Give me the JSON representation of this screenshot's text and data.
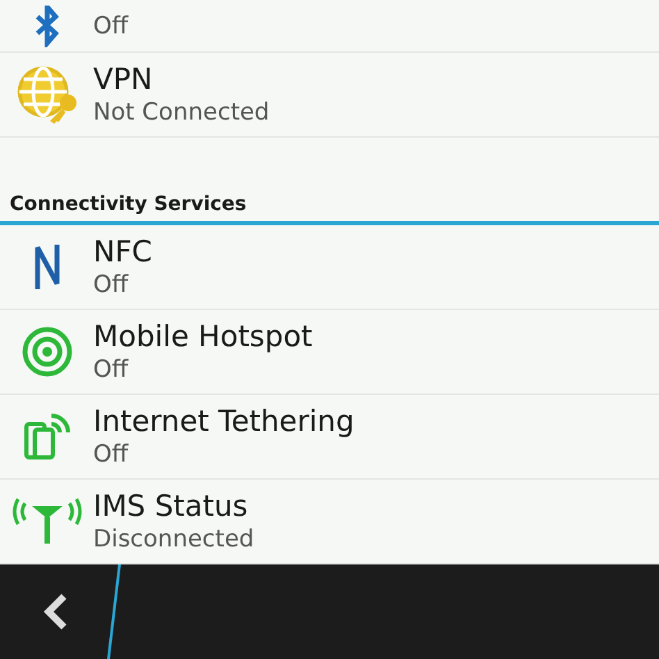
{
  "top_items": [
    {
      "kind": "bluetooth",
      "status": "Off"
    },
    {
      "kind": "vpn",
      "title": "VPN",
      "status": "Not Connected"
    }
  ],
  "section": {
    "title": "Connectivity Services"
  },
  "items": [
    {
      "kind": "nfc",
      "title": "NFC",
      "status": "Off"
    },
    {
      "kind": "hotspot",
      "title": "Mobile Hotspot",
      "status": "Off"
    },
    {
      "kind": "tethering",
      "title": "Internet Tethering",
      "status": "Off"
    },
    {
      "kind": "ims",
      "title": "IMS Status",
      "status": "Disconnected"
    }
  ]
}
